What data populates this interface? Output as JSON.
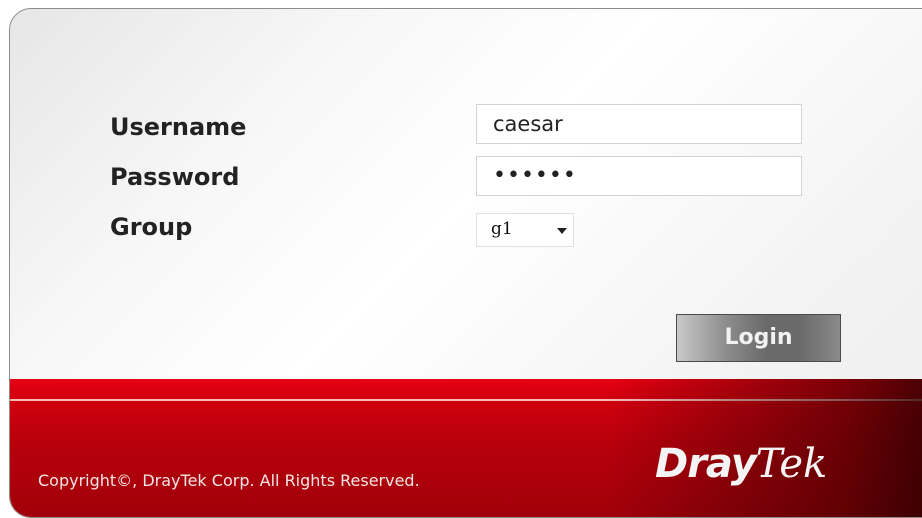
{
  "form": {
    "username_label": "Username",
    "username_value": "caesar",
    "password_label": "Password",
    "password_mask": "••••••",
    "group_label": "Group",
    "group_selected": "g1",
    "login_button": "Login"
  },
  "footer": {
    "copyright": "Copyright©, DrayTek Corp. All Rights Reserved.",
    "logo_part1": "Dray",
    "logo_part2": "Tek"
  },
  "colors": {
    "footer_red": "#d4000f",
    "button_gray": "#6a6a6a"
  }
}
